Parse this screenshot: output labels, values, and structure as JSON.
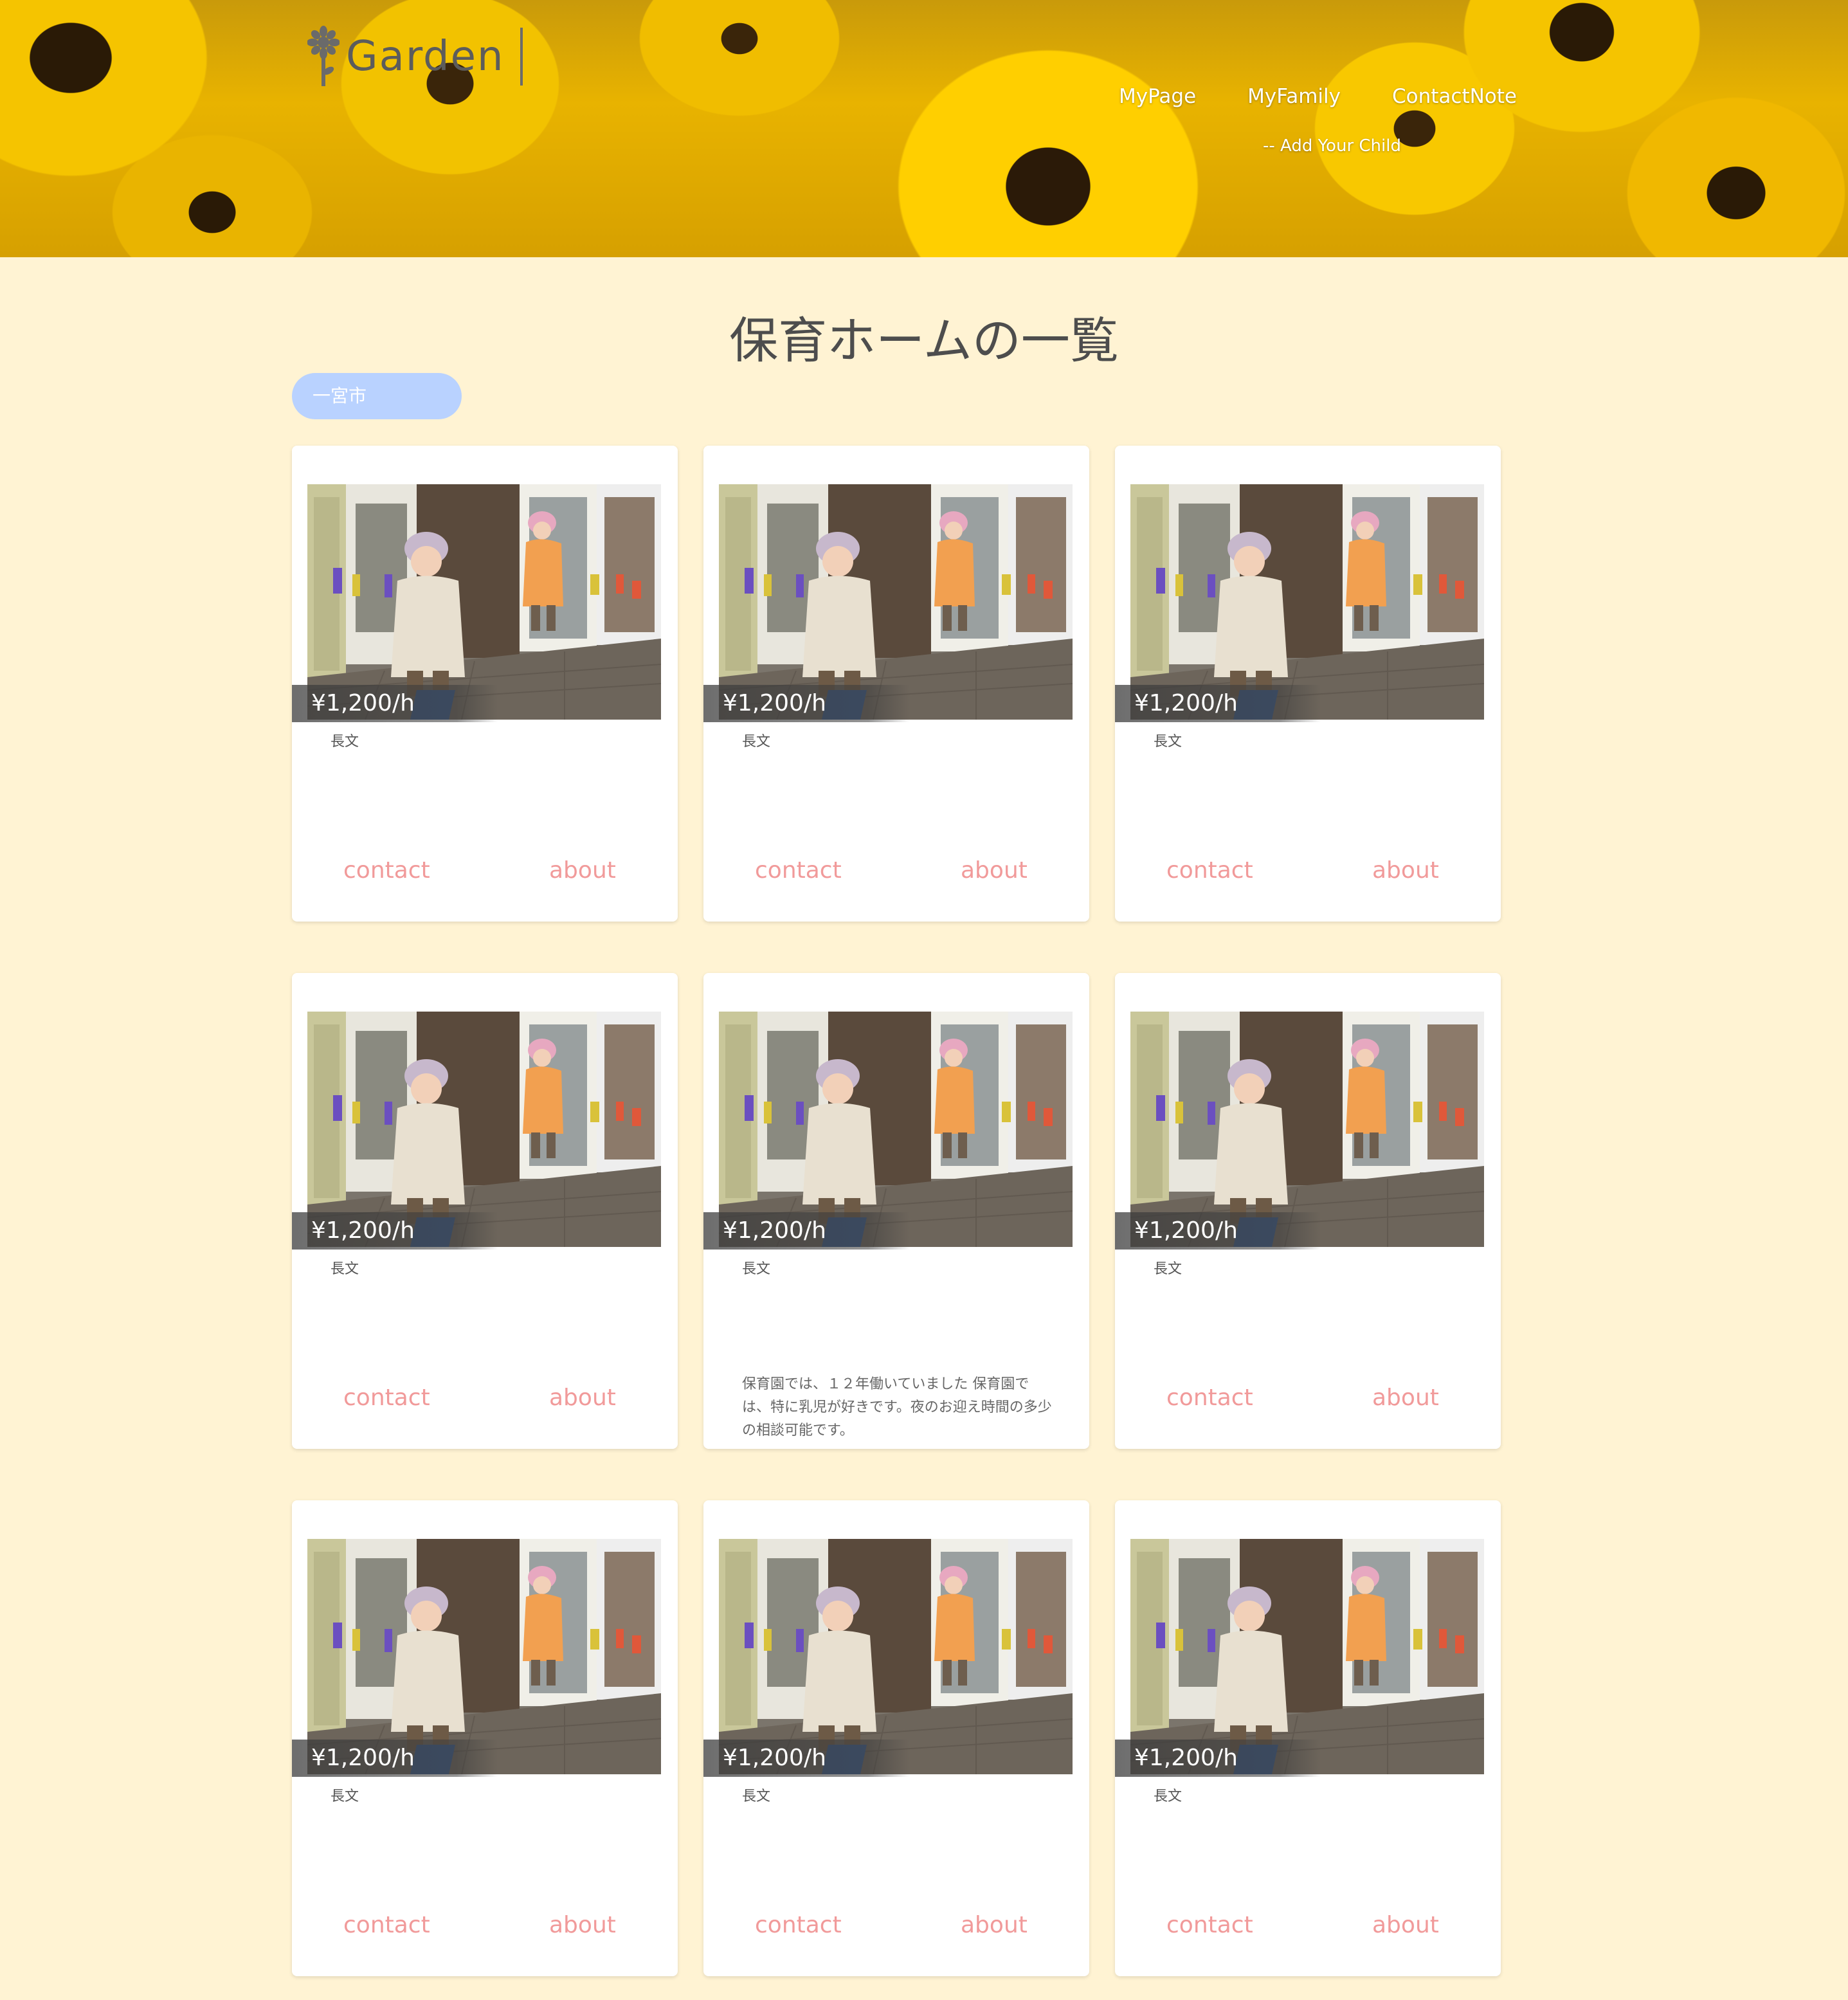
{
  "header": {
    "logo_text": "Garden",
    "nav": [
      "MyPage",
      "MyFamily",
      "ContactNote"
    ],
    "nav_sub": "-- Add Your Child"
  },
  "main": {
    "title": "保育ホームの一覧",
    "area_filter": "一宮市",
    "cards": [
      {
        "price": "¥1,200/h",
        "summary": "長文",
        "description": "",
        "contact": "contact",
        "about": "about"
      },
      {
        "price": "¥1,200/h",
        "summary": "長文",
        "description": "",
        "contact": "contact",
        "about": "about"
      },
      {
        "price": "¥1,200/h",
        "summary": "長文",
        "description": "",
        "contact": "contact",
        "about": "about"
      },
      {
        "price": "¥1,200/h",
        "summary": "長文",
        "description": "",
        "contact": "contact",
        "about": "about"
      },
      {
        "price": "¥1,200/h",
        "summary": "長文",
        "description": "保育園では、１２年働いていました 保育園では、特に乳児が好きです。夜のお迎え時間の多少の相談可能です。",
        "contact": "",
        "about": ""
      },
      {
        "price": "¥1,200/h",
        "summary": "長文",
        "description": "",
        "contact": "contact",
        "about": "about"
      },
      {
        "price": "¥1,200/h",
        "summary": "長文",
        "description": "",
        "contact": "contact",
        "about": "about"
      },
      {
        "price": "¥1,200/h",
        "summary": "長文",
        "description": "",
        "contact": "contact",
        "about": "about"
      },
      {
        "price": "¥1,200/h",
        "summary": "長文",
        "description": "",
        "contact": "contact",
        "about": "about"
      }
    ]
  },
  "colors": {
    "page_bg": "#fff3d3",
    "area_pill": "#b9d2ff",
    "action_text": "#f19a9a",
    "title_text": "#4d4d4d"
  },
  "icons": {
    "logo": "sunflower-logo-icon"
  }
}
